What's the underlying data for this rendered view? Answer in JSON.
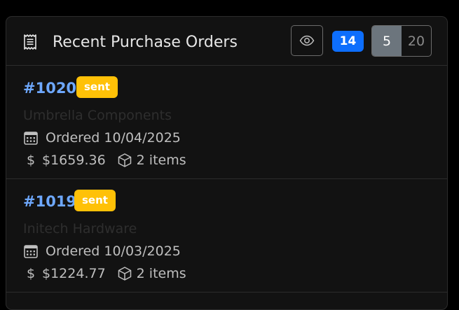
{
  "header": {
    "title": "Recent Purchase Orders",
    "icon": "receipt-icon",
    "view_icon": "eye-icon",
    "count": "14",
    "count_color": "#0d6efd",
    "page_sizes": [
      "5",
      "20"
    ],
    "active_page_size": "5"
  },
  "orders": [
    {
      "id": "#1020",
      "status": "sent",
      "supplier": "Umbrella Components",
      "ordered": "Ordered 10/04/2025",
      "total": "$1659.36",
      "items": "2 items"
    },
    {
      "id": "#1019",
      "status": "sent",
      "supplier": "Initech Hardware",
      "ordered": "Ordered 10/03/2025",
      "total": "$1224.77",
      "items": "2 items"
    }
  ],
  "icons": {
    "dollar_glyph": "$",
    "calendar": "calendar-icon",
    "items": "box-icon"
  },
  "colors": {
    "link": "#6ea8fe",
    "status_sent": "#ffc107",
    "page_size_active": "#6c757d"
  }
}
